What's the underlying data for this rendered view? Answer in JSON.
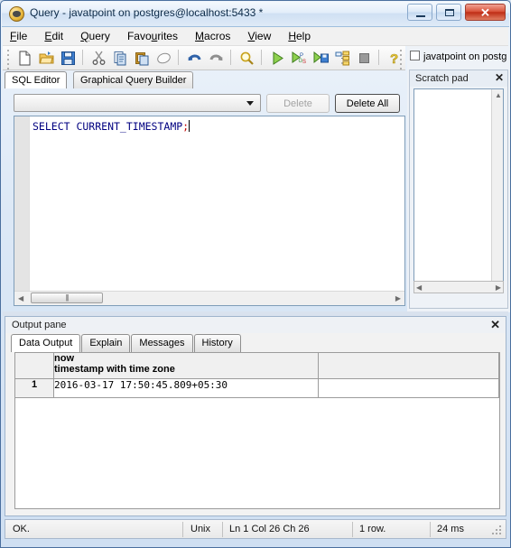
{
  "window": {
    "title": "Query - javatpoint on postgres@localhost:5433 *",
    "icon": "pgadmin-elephant-icon",
    "buttons": {
      "minimize": "minimize-button",
      "maximize": "maximize-button",
      "close_label": "✕"
    }
  },
  "menu": [
    {
      "label": "File",
      "accel": "F"
    },
    {
      "label": "Edit",
      "accel": "E"
    },
    {
      "label": "Query",
      "accel": "Q"
    },
    {
      "label": "Favourites",
      "accel": "u"
    },
    {
      "label": "Macros",
      "accel": "M"
    },
    {
      "label": "View",
      "accel": "V"
    },
    {
      "label": "Help",
      "accel": "H"
    }
  ],
  "toolbar": {
    "buttons": [
      {
        "name": "new-query-icon",
        "title": "New"
      },
      {
        "name": "open-file-icon",
        "title": "Open"
      },
      {
        "name": "save-icon",
        "title": "Save"
      },
      {
        "name": "cut-icon",
        "title": "Cut"
      },
      {
        "name": "copy-icon",
        "title": "Copy"
      },
      {
        "name": "paste-icon",
        "title": "Paste"
      },
      {
        "name": "clear-window-icon",
        "title": "Clear window"
      },
      {
        "name": "undo-icon",
        "title": "Undo"
      },
      {
        "name": "redo-icon",
        "title": "Redo"
      },
      {
        "name": "find-replace-icon",
        "title": "Find"
      },
      {
        "name": "execute-query-icon",
        "title": "Execute query"
      },
      {
        "name": "execute-pgscript-icon",
        "title": "Execute pgScript"
      },
      {
        "name": "execute-to-file-icon",
        "title": "Execute to file"
      },
      {
        "name": "explain-query-icon",
        "title": "Explain query"
      },
      {
        "name": "stop-icon",
        "title": "Cancel"
      },
      {
        "name": "help-icon",
        "title": "Help"
      }
    ]
  },
  "connection": {
    "checkbox_checked": false,
    "label": "javatpoint on postg"
  },
  "scratch_pad": {
    "title": "Scratch pad",
    "close_label": "✕",
    "content": ""
  },
  "editor_tabs": [
    {
      "label": "SQL Editor",
      "active": true
    },
    {
      "label": "Graphical Query Builder",
      "active": false
    }
  ],
  "query_bar": {
    "combo_value": "",
    "combo_placeholder": "",
    "delete_label": "Delete",
    "delete_enabled": false,
    "delete_all_label": "Delete All",
    "delete_all_enabled": true
  },
  "sql_editor": {
    "text_keyword": "SELECT CURRENT_TIMESTAMP",
    "text_terminator": ";"
  },
  "output_pane": {
    "title": "Output pane",
    "close_label": "✕",
    "tabs": [
      {
        "label": "Data Output",
        "active": true
      },
      {
        "label": "Explain",
        "active": false
      },
      {
        "label": "Messages",
        "active": false
      },
      {
        "label": "History",
        "active": false
      }
    ],
    "grid": {
      "columns": [
        {
          "name": "now",
          "type": "timestamp with time zone"
        }
      ],
      "rows": [
        {
          "num": "1",
          "values": [
            "2016-03-17 17:50:45.809+05:30"
          ]
        }
      ]
    }
  },
  "status_bar": {
    "message": "OK.",
    "line_endings": "Unix",
    "position": "Ln 1 Col 26 Ch 26",
    "rows": "1 row.",
    "duration": "24 ms"
  }
}
